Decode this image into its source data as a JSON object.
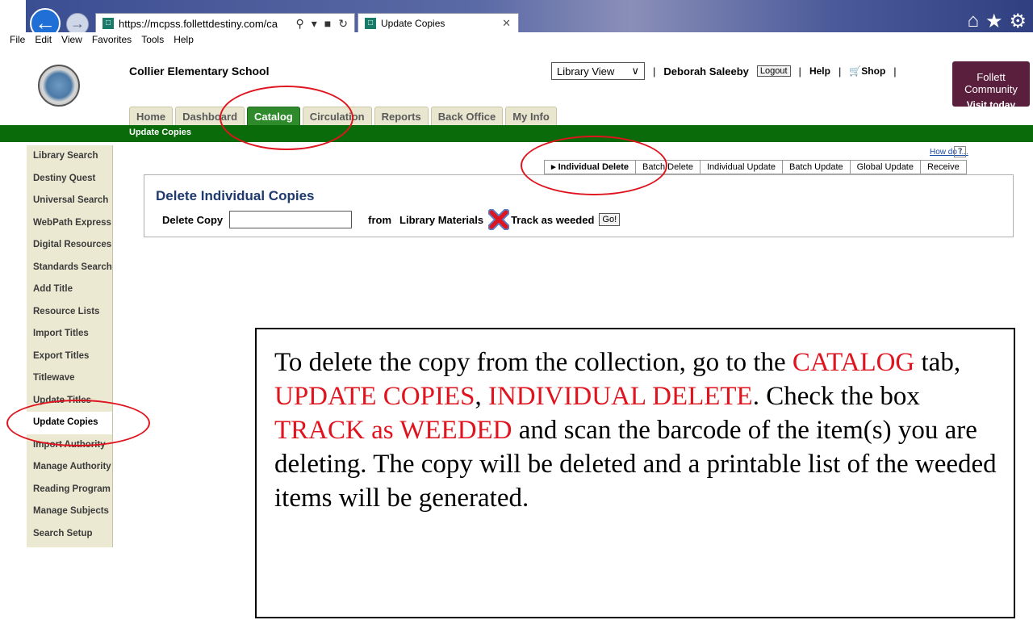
{
  "browser": {
    "url": "https://mcpss.follettdestiny.com/ca",
    "tab_title": "Update Copies",
    "menu": [
      "File",
      "Edit",
      "View",
      "Favorites",
      "Tools",
      "Help"
    ]
  },
  "header": {
    "school_name": "Collier Elementary School",
    "view_select": "Library View",
    "user_name": "Deborah Saleeby",
    "logout_label": "Logout",
    "help_label": "Help",
    "shop_label": "Shop",
    "promo_title": "Follett Community",
    "promo_sub": "Visit today"
  },
  "main_tabs": [
    {
      "label": "Home"
    },
    {
      "label": "Dashboard"
    },
    {
      "label": "Catalog"
    },
    {
      "label": "Circulation"
    },
    {
      "label": "Reports"
    },
    {
      "label": "Back Office"
    },
    {
      "label": "My Info"
    }
  ],
  "sub_nav_label": "Update Copies",
  "sidebar": {
    "items": [
      {
        "label": "Library Search"
      },
      {
        "label": "Destiny Quest"
      },
      {
        "label": "Universal Search"
      },
      {
        "label": "WebPath Express"
      },
      {
        "label": "Digital Resources"
      },
      {
        "label": "Standards Search"
      },
      {
        "label": "Add Title"
      },
      {
        "label": "Resource Lists"
      },
      {
        "label": "Import Titles"
      },
      {
        "label": "Export Titles"
      },
      {
        "label": "Titlewave"
      },
      {
        "label": "Update Titles"
      },
      {
        "label": "Update Copies"
      },
      {
        "label": "Import Authority"
      },
      {
        "label": "Manage Authority"
      },
      {
        "label": "Reading Program"
      },
      {
        "label": "Manage Subjects"
      },
      {
        "label": "Search Setup"
      }
    ]
  },
  "content": {
    "howdo_label": "How do I...",
    "help_q": "?",
    "sub_tabs": [
      {
        "label": "Individual Delete"
      },
      {
        "label": "Batch Delete"
      },
      {
        "label": "Individual Update"
      },
      {
        "label": "Batch Update"
      },
      {
        "label": "Global Update"
      },
      {
        "label": "Receive"
      }
    ],
    "panel_title": "Delete Individual Copies",
    "delete_copy_label": "Delete Copy",
    "from_label": "from",
    "library_materials_label": "Library Materials",
    "track_label": "Track as weeded",
    "go_label": "Go!"
  },
  "note": {
    "p1": "To delete the copy from the collection, go to the ",
    "r1": "CATALOG",
    "p2": " tab, ",
    "r2": "UPDATE COPIES",
    "p3": ", ",
    "r3": "INDIVIDUAL DELETE",
    "p4": ".  Check the box ",
    "r4": "TRACK as WEEDED",
    "p5": " and scan the barcode of the item(s) you are deleting.  The copy will be deleted and a printable list of the weeded items will be generated."
  }
}
